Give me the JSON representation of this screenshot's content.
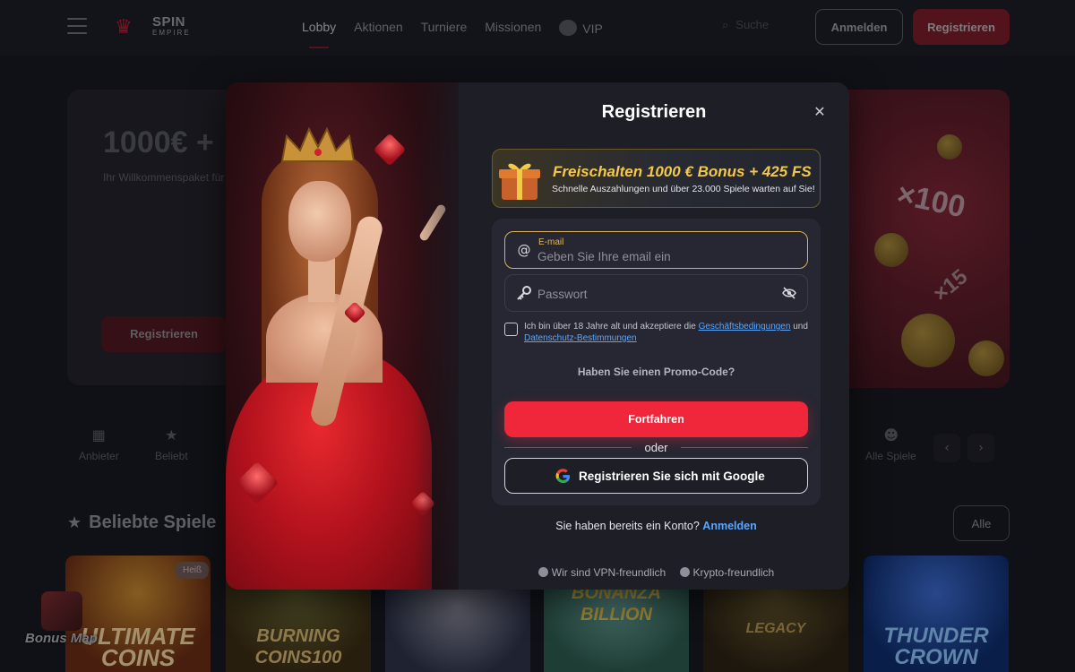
{
  "header": {
    "logo_text": "SPIN",
    "logo_subtext": "EMPIRE",
    "nav": [
      {
        "label": "Lobby"
      },
      {
        "label": "Aktionen"
      },
      {
        "label": "Turniere"
      },
      {
        "label": "Missionen"
      },
      {
        "label": "VIP"
      }
    ],
    "search_placeholder": "Suche",
    "login_label": "Anmelden",
    "register_label": "Registrieren"
  },
  "hero": {
    "title": "1000€ +",
    "subtitle": "Ihr Willkommenspaket für",
    "cta_label": "Registrieren",
    "badge_x100": "×100",
    "badge_x15": "×15"
  },
  "categories": [
    {
      "label": "Anbieter",
      "icon": "grid-icon"
    },
    {
      "label": "Beliebt",
      "icon": "star-icon"
    },
    {
      "label": "Alle Spiele",
      "icon": "smile-icon"
    }
  ],
  "popular": {
    "title": "Beliebte Spiele",
    "all_label": "Alle",
    "hot_badge": "Heiß",
    "games": [
      {
        "name": "ULTIMATE COINS"
      },
      {
        "name": "BURNING COINS100"
      },
      {
        "name": ""
      },
      {
        "name": "BONANZA BILLION"
      },
      {
        "name": "LEGACY"
      },
      {
        "name": "THUNDER CROWN"
      }
    ]
  },
  "bonus_map_label": "Bonus Map",
  "modal": {
    "title": "Registrieren",
    "close_icon": "close-icon",
    "banner": {
      "title": "Freischalten 1000 € Bonus + 425 FS",
      "subtitle": "Schnelle Auszahlungen und über 23.000 Spiele warten auf Sie!"
    },
    "email": {
      "label": "E-mail",
      "placeholder": "Geben Sie Ihre email ein",
      "value": ""
    },
    "password": {
      "placeholder": "Passwort",
      "value": ""
    },
    "terms": {
      "text_before": "Ich bin über 18 Jahre alt und akzeptiere die",
      "link_terms": "Geschäftsbedingungen",
      "text_and": "und",
      "link_privacy": "Datenschutz-Bestimmungen"
    },
    "promo_code_label": "Haben Sie einen Promo-Code?",
    "continue_label": "Fortfahren",
    "or_label": "oder",
    "google_label": "Registrieren Sie sich mit Google",
    "have_account_text": "Sie haben bereits ein Konto?",
    "have_account_link": "Anmelden",
    "footer": {
      "vpn": "Wir sind VPN-freundlich",
      "crypto": "Krypto-freundlich"
    }
  },
  "colors": {
    "accent_red": "#f0263b",
    "gold": "#f3c84b",
    "link_blue": "#5aa7ff",
    "modal_bg": "#1d1e26",
    "page_bg": "#15161c"
  }
}
